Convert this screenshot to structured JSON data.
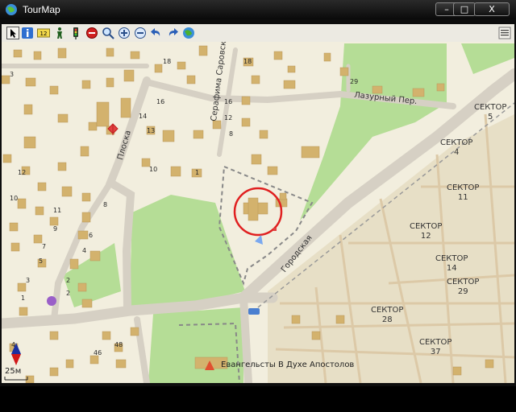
{
  "window": {
    "title": "TourMap",
    "minimize_label": "–",
    "maximize_label": "□",
    "close_label": "X"
  },
  "toolbar": {
    "tools": [
      {
        "name": "select-arrow-icon"
      },
      {
        "name": "info-icon"
      },
      {
        "name": "number-label-icon",
        "text": "12"
      },
      {
        "name": "pedestrian-icon"
      },
      {
        "name": "traffic-light-icon"
      },
      {
        "name": "stop-icon"
      },
      {
        "name": "search-icon"
      },
      {
        "name": "zoom-in-icon"
      },
      {
        "name": "zoom-out-icon"
      },
      {
        "name": "undo-icon"
      },
      {
        "name": "redo-icon"
      },
      {
        "name": "globe-icon"
      },
      {
        "name": "menu-list-icon"
      }
    ]
  },
  "map": {
    "streets": {
      "saroskogo": "Серафима Саровского ул.",
      "lazurny": "Лазурный Пер.",
      "gorodskaya": "Городская",
      "ploska": "Плоска"
    },
    "sectors": [
      {
        "label": "СЕКТОР",
        "num": "5"
      },
      {
        "label": "СЕКТОР",
        "num": "4"
      },
      {
        "label": "СЕКТОР",
        "num": "11"
      },
      {
        "label": "СЕКТОР",
        "num": "12"
      },
      {
        "label": "СЕКТОР",
        "num": "14"
      },
      {
        "label": "СЕКТОР",
        "num": "29"
      },
      {
        "label": "СЕКТОР",
        "num": "28"
      },
      {
        "label": "СЕКТОР",
        "num": "37"
      }
    ],
    "house_numbers": [
      "18",
      "16",
      "14",
      "3",
      "13",
      "12",
      "10",
      "11",
      "8",
      "9",
      "7",
      "6",
      "5",
      "4",
      "3",
      "2",
      "1",
      "10",
      "1",
      "16",
      "12",
      "8",
      "18",
      "29",
      "48",
      "46",
      "4",
      "2"
    ],
    "poi_label": "Евангельсты В Духе Апостолов",
    "scale": "25м",
    "colors": {
      "background": "#f2eede",
      "park": "#b5dd96",
      "building": "#d3b26d",
      "road": "#d5cec0",
      "sector_area": "#e7dfc6",
      "marker": "#e02020"
    }
  }
}
